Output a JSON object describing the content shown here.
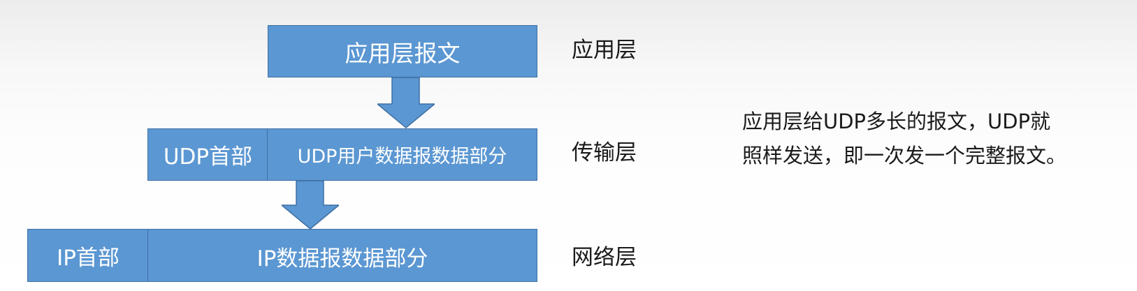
{
  "application_layer": {
    "message_box": "应用层报文",
    "layer_label": "应用层"
  },
  "transport_layer": {
    "header_box": "UDP首部",
    "data_box": "UDP用户数据报数据部分",
    "layer_label": "传输层"
  },
  "network_layer": {
    "header_box": "IP首部",
    "data_box": "IP数据报数据部分",
    "layer_label": "网络层"
  },
  "note": {
    "line1": "应用层给UDP多长的报文，UDP就",
    "line2": "照样发送，即一次发一个完整报文。"
  },
  "colors": {
    "box_fill": "#5b97d2",
    "box_border": "#3f70a4",
    "text_on_box": "#ffffff"
  }
}
